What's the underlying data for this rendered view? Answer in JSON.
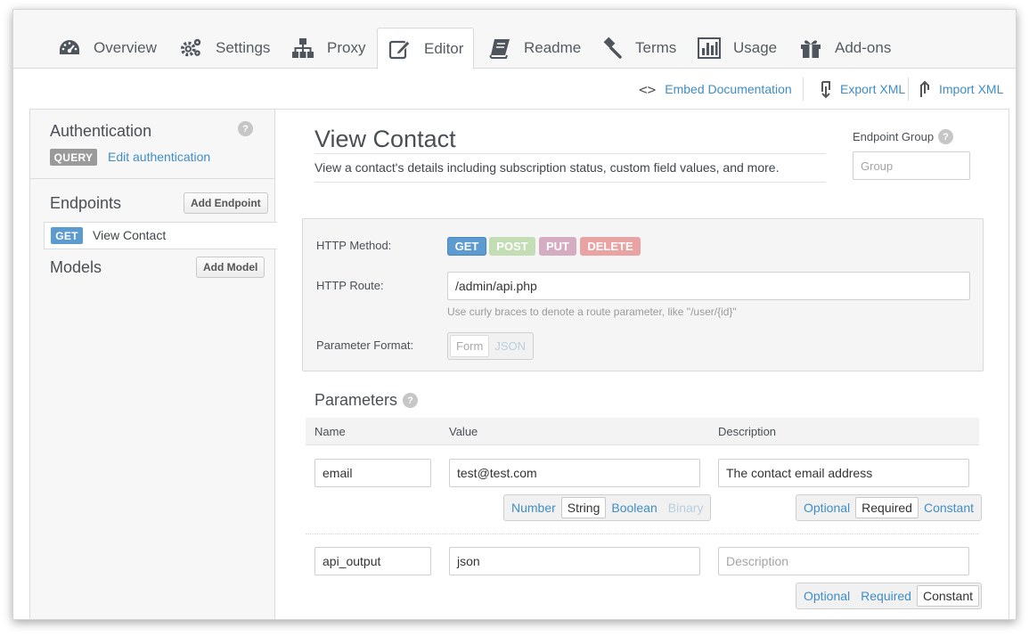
{
  "tabs": [
    {
      "label": "Overview",
      "icon": "dashboard-icon",
      "active": false
    },
    {
      "label": "Settings",
      "icon": "gears-icon",
      "active": false
    },
    {
      "label": "Proxy",
      "icon": "sitemap-icon",
      "active": false
    },
    {
      "label": "Editor",
      "icon": "edit-icon",
      "active": true
    },
    {
      "label": "Readme",
      "icon": "book-icon",
      "active": false
    },
    {
      "label": "Terms",
      "icon": "gavel-icon",
      "active": false
    },
    {
      "label": "Usage",
      "icon": "bar-chart-icon",
      "active": false
    },
    {
      "label": "Add-ons",
      "icon": "gift-icon",
      "active": false
    }
  ],
  "toolbar": {
    "embed_glyph": "<>",
    "embed_label": "Embed Documentation",
    "export_label": "Export XML",
    "import_label": "Import XML"
  },
  "sidebar": {
    "auth_title": "Authentication",
    "auth_badge": "QUERY",
    "auth_link": "Edit authentication",
    "endpoints_title": "Endpoints",
    "add_endpoint": "Add Endpoint",
    "endpoint_method": "GET",
    "endpoint_name": "View Contact",
    "models_title": "Models",
    "add_model": "Add Model",
    "help_glyph": "?"
  },
  "endpoint": {
    "title": "View Contact",
    "description": "View a contact's details including subscription status, custom field values, and more.",
    "group_label": "Endpoint Group",
    "group_placeholder": "Group"
  },
  "http": {
    "method_label": "HTTP Method:",
    "methods": [
      "GET",
      "POST",
      "PUT",
      "DELETE"
    ],
    "selected_method": "GET",
    "route_label": "HTTP Route:",
    "route_value": "/admin/api.php",
    "route_hint": "Use curly braces to denote a route parameter, like \"/user/{id}\"",
    "format_label": "Parameter Format:",
    "formats": [
      "Form",
      "JSON"
    ]
  },
  "parameters": {
    "title": "Parameters",
    "columns": [
      "Name",
      "Value",
      "Description"
    ],
    "type_options": [
      "Number",
      "String",
      "Boolean",
      "Binary"
    ],
    "req_options": [
      "Optional",
      "Required",
      "Constant"
    ],
    "rows": [
      {
        "name": "email",
        "value": "test@test.com",
        "description": "The contact email address",
        "description_placeholder": "",
        "type": "String",
        "requirement": "Required"
      },
      {
        "name": "api_output",
        "value": "json",
        "description": "",
        "description_placeholder": "Description",
        "type": null,
        "requirement": "Constant"
      }
    ]
  },
  "colors": {
    "link": "#3f8dc7",
    "get": "#5b9bd0",
    "post": "#c3ddb5",
    "put": "#d5adc3",
    "delete": "#e9a3a3",
    "query_badge": "#9a9a9a"
  }
}
